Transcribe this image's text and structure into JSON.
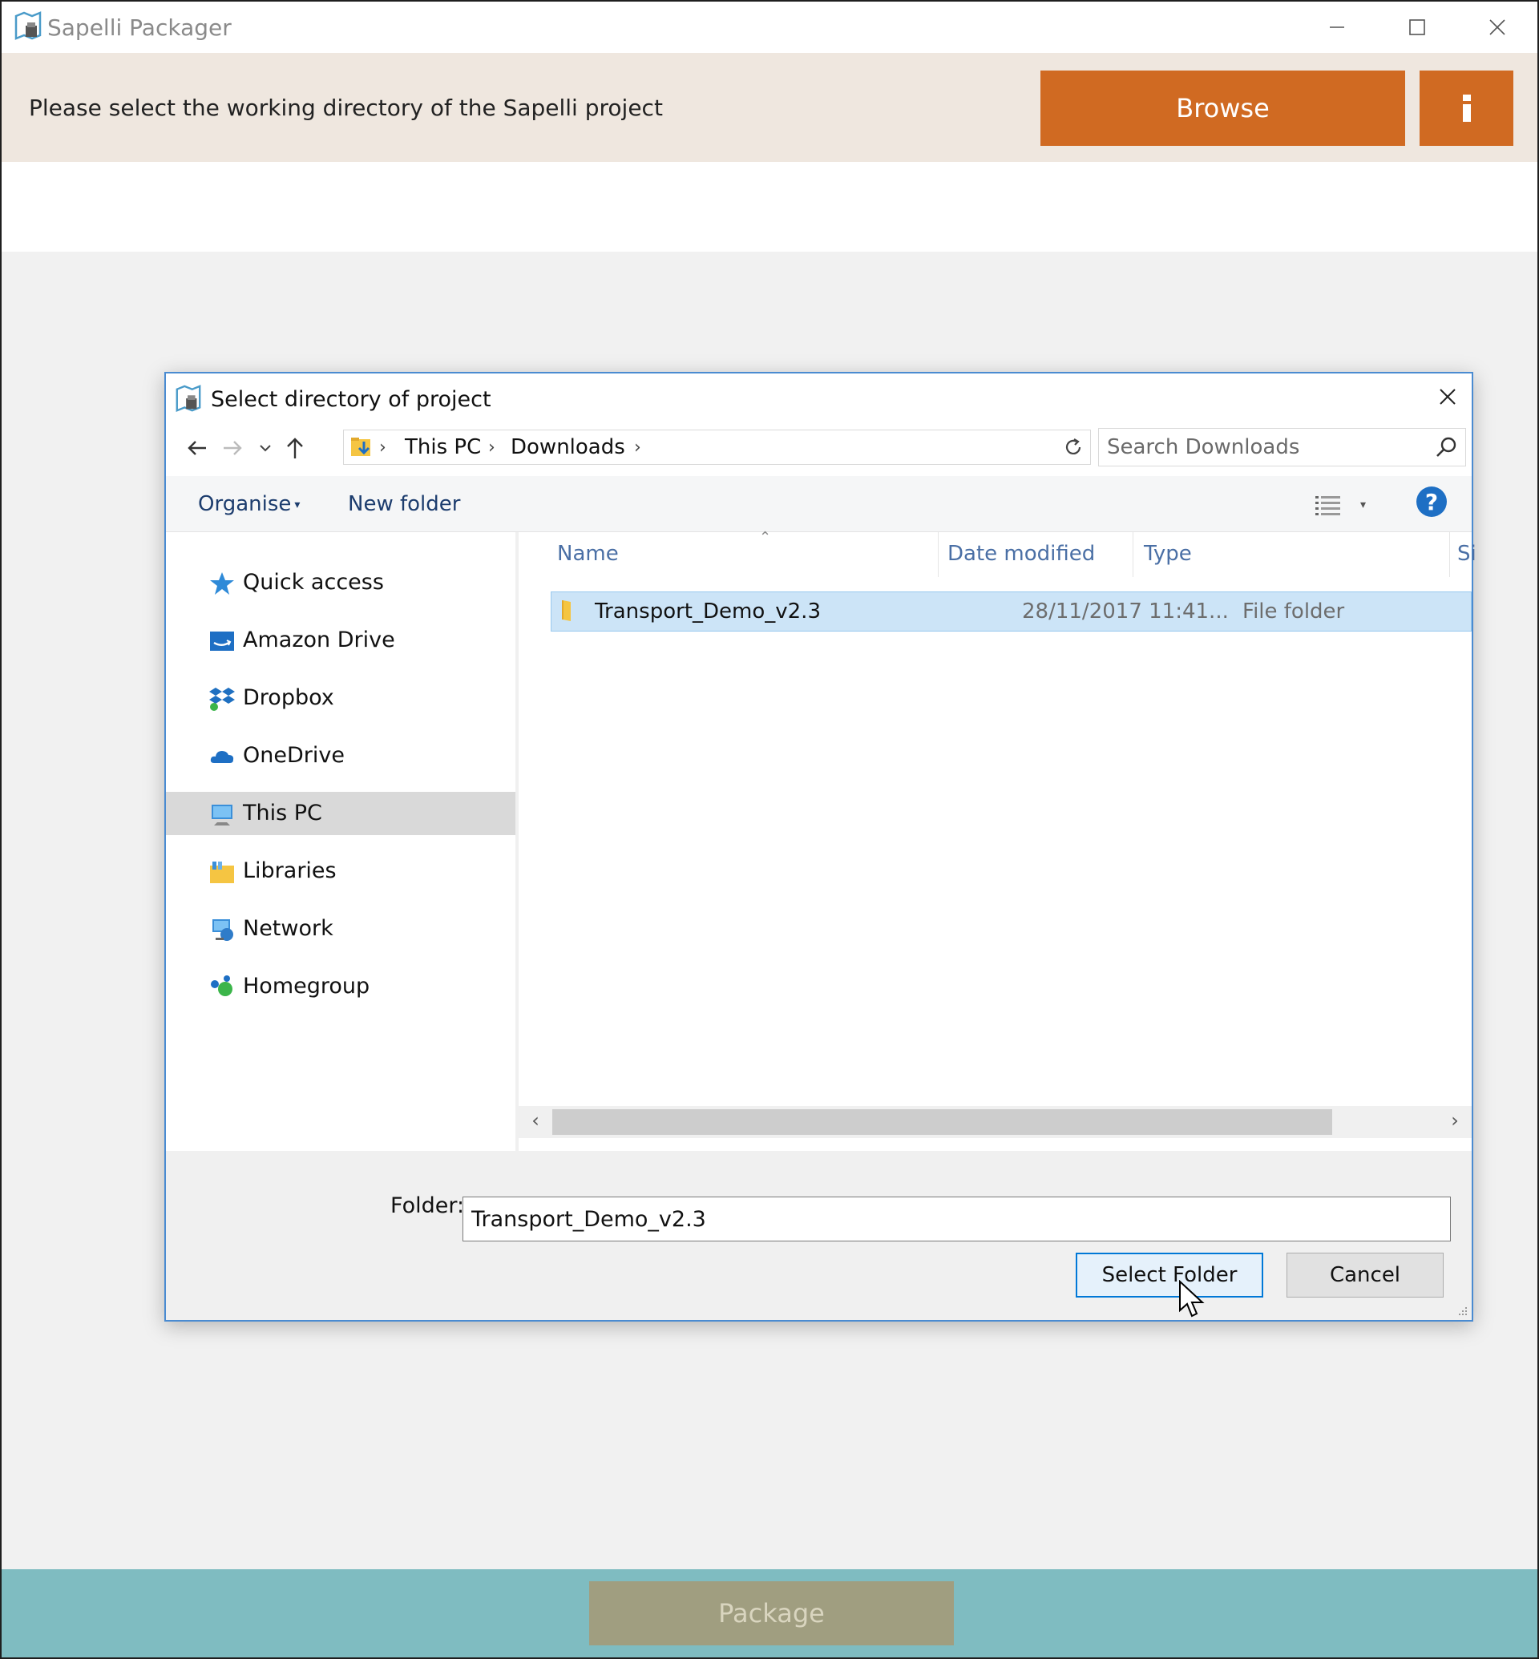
{
  "app": {
    "title": "Sapelli Packager",
    "prompt": "Please select the working directory of the Sapelli project",
    "browse_label": "Browse",
    "info_label": "i",
    "package_label": "Package"
  },
  "dialog": {
    "title": "Select directory of project",
    "breadcrumbs": [
      "This PC",
      "Downloads"
    ],
    "search_placeholder": "Search Downloads",
    "toolbar": {
      "organise_label": "Organise",
      "new_folder_label": "New folder",
      "help_label": "?"
    },
    "nav_items": [
      {
        "label": "Quick access",
        "icon": "star-icon"
      },
      {
        "label": "Amazon Drive",
        "icon": "amazon-drive-icon"
      },
      {
        "label": "Dropbox",
        "icon": "dropbox-icon"
      },
      {
        "label": "OneDrive",
        "icon": "onedrive-icon"
      },
      {
        "label": "This PC",
        "icon": "computer-icon",
        "selected": true
      },
      {
        "label": "Libraries",
        "icon": "libraries-icon"
      },
      {
        "label": "Network",
        "icon": "network-icon"
      },
      {
        "label": "Homegroup",
        "icon": "homegroup-icon"
      }
    ],
    "columns": {
      "name": "Name",
      "date": "Date modified",
      "type": "Type",
      "size": "Si"
    },
    "files": [
      {
        "name": "Transport_Demo_v2.3",
        "date": "28/11/2017 11:41...",
        "type": "File folder",
        "selected": true
      }
    ],
    "folder_label": "Folder:",
    "folder_value": "Transport_Demo_v2.3",
    "select_label": "Select Folder",
    "cancel_label": "Cancel"
  },
  "colors": {
    "accent_orange": "#d06a22",
    "header_band": "#efe7df",
    "bottom_bar": "#7fbcc1",
    "package_disabled": "#a09e80",
    "selection_blue": "#cce4f7",
    "dialog_border": "#4a8bd1"
  }
}
